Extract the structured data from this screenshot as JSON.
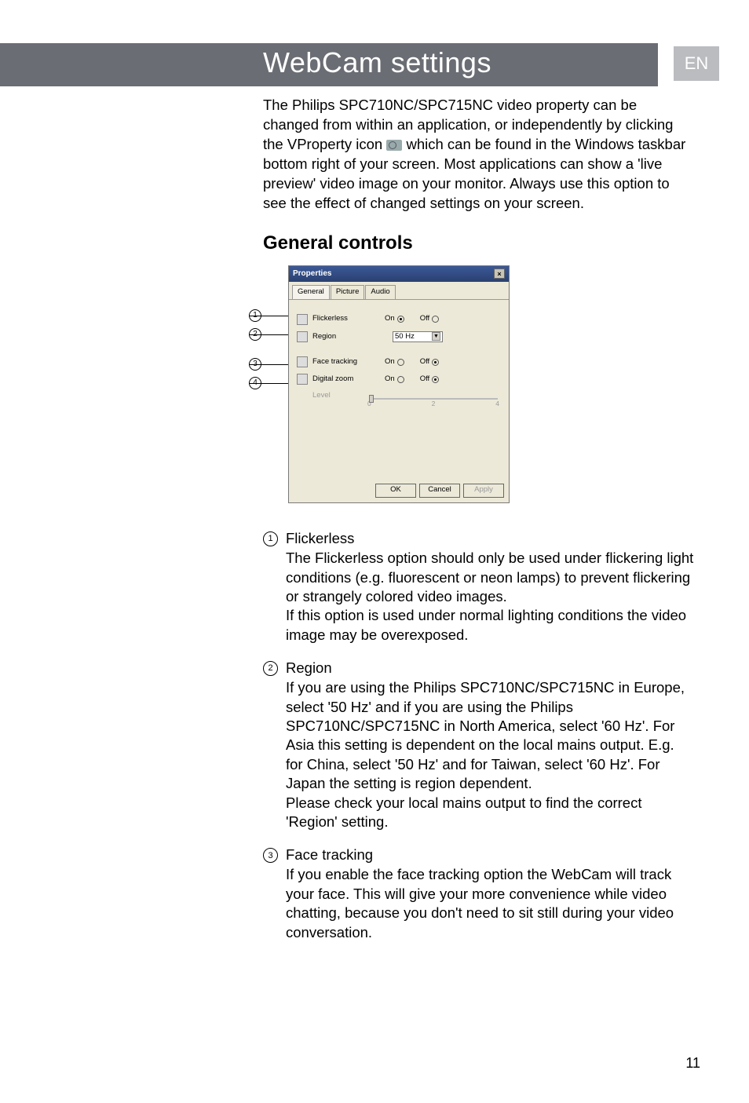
{
  "header": {
    "title": "WebCam settings",
    "lang_badge": "EN"
  },
  "intro": {
    "text_before_icon": "The Philips SPC710NC/SPC715NC video property can be changed from within an application, or independently by clicking the VProperty icon ",
    "text_after_icon": " which can be found in the Windows taskbar bottom right of your screen. Most applications can show a 'live preview' video image on your monitor. Always use this option to see the effect of changed settings on your screen."
  },
  "section_title": "General controls",
  "dialog": {
    "title": "Properties",
    "tabs": [
      "General",
      "Picture",
      "Audio"
    ],
    "rows": {
      "flickerless": {
        "label": "Flickerless",
        "on": "On",
        "off": "Off",
        "selected": "on"
      },
      "region": {
        "label": "Region",
        "value": "50 Hz"
      },
      "face_tracking": {
        "label": "Face tracking",
        "on": "On",
        "off": "Off",
        "selected": "off"
      },
      "digital_zoom": {
        "label": "Digital zoom",
        "on": "On",
        "off": "Off",
        "selected": "off"
      },
      "level": {
        "label": "Level",
        "ticks": [
          "0",
          "2",
          "4"
        ]
      }
    },
    "buttons": {
      "ok": "OK",
      "cancel": "Cancel",
      "apply": "Apply"
    }
  },
  "callout_nums": [
    "1",
    "2",
    "3",
    "4"
  ],
  "descriptions": [
    {
      "num": "1",
      "title": "Flickerless",
      "body": "The Flickerless option should only be used under flickering light conditions (e.g. fluorescent or neon lamps) to prevent flickering or strangely colored video images.\nIf this option is used under normal lighting conditions the video image may be overexposed."
    },
    {
      "num": "2",
      "title": "Region",
      "body": "If you are using the Philips SPC710NC/SPC715NC in Europe, select '50 Hz' and if you are using the Philips SPC710NC/SPC715NC in North America, select '60 Hz'. For Asia this setting is dependent on the local mains output. E.g. for China, select '50 Hz' and for Taiwan, select '60 Hz'. For Japan the setting is region dependent.\nPlease check your local mains output to find the correct 'Region' setting."
    },
    {
      "num": "3",
      "title": "Face tracking",
      "body": "If you enable the face tracking option the WebCam will track your face. This will give your more convenience while video chatting, because you don't need to sit still during your video conversation."
    }
  ],
  "page_number": "11"
}
